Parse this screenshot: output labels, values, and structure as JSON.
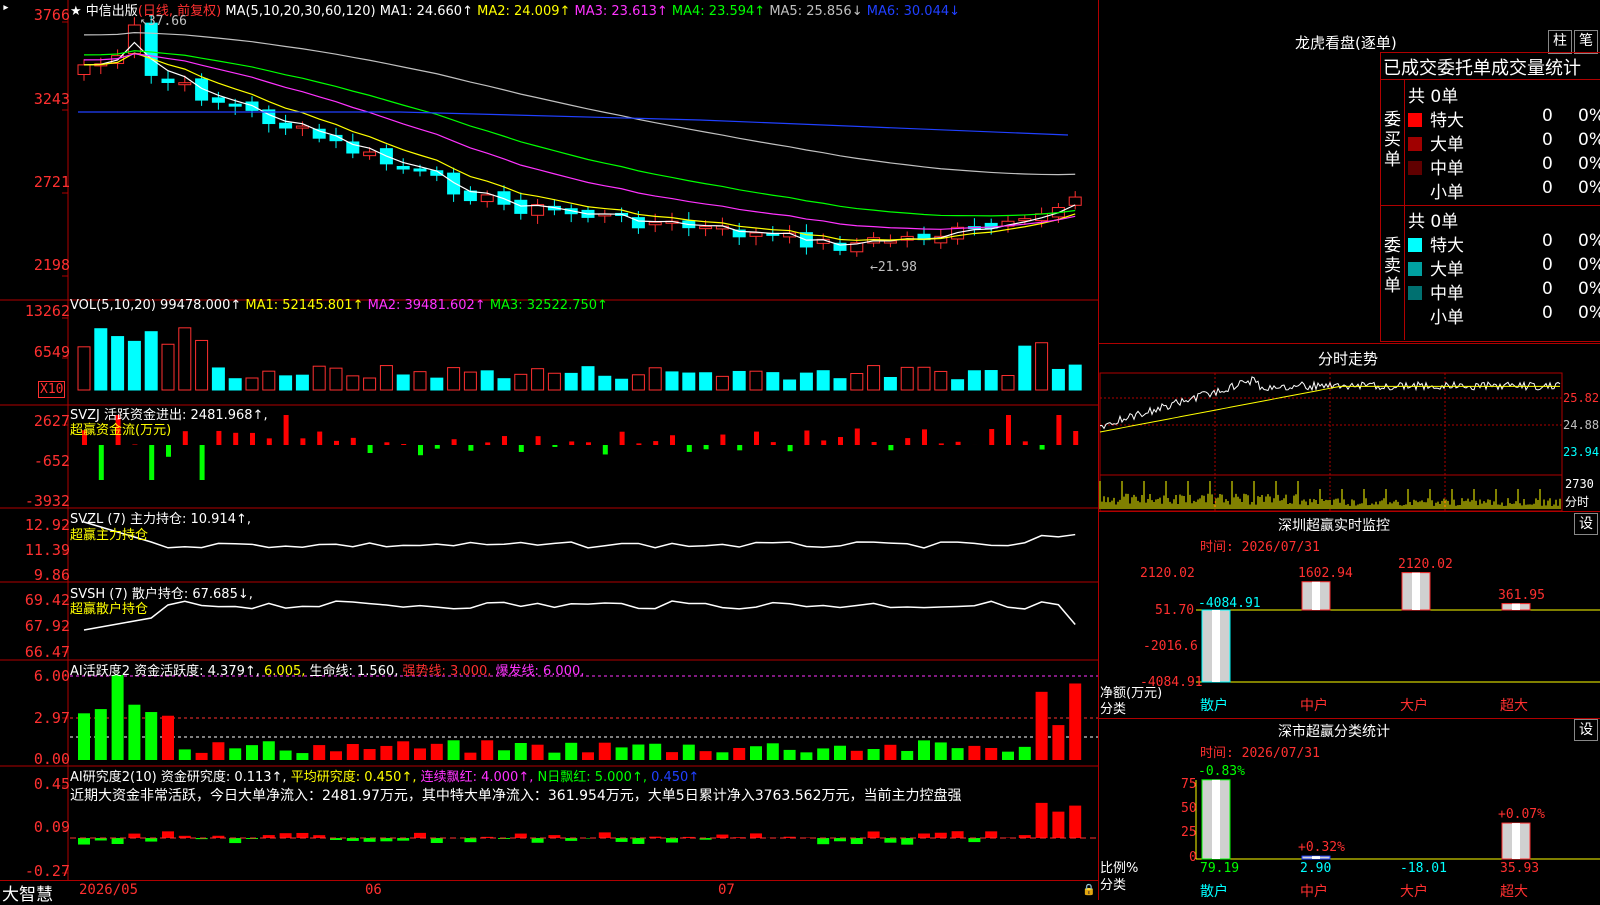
{
  "stock": {
    "star": "★",
    "name": "中信出版",
    "period": "(日线, 前复权)"
  },
  "main_ma": {
    "label": "MA(5,10,20,30,60,120)",
    "items": [
      {
        "text": "MA1: 24.660↑",
        "color": "#ffffff"
      },
      {
        "text": "MA2: 24.009↑",
        "color": "#ffff00"
      },
      {
        "text": "MA3: 23.613↑",
        "color": "#ff33ff"
      },
      {
        "text": "MA4: 23.594↑",
        "color": "#00ff00"
      },
      {
        "text": "MA5: 25.856↓",
        "color": "#c0c0c0"
      },
      {
        "text": "MA6: 30.044↓",
        "color": "#2040ff"
      }
    ]
  },
  "price_axis": [
    "3766",
    "3243",
    "2721",
    "2198"
  ],
  "price_high_label": "37.66",
  "price_low_label": "←21.98",
  "vol": {
    "label": "VOL(5,10,20)",
    "value": "99478.000↑",
    "items": [
      {
        "text": "MA1: 52145.801↑",
        "color": "#ffff00"
      },
      {
        "text": "MA2: 39481.602↑",
        "color": "#ff33ff"
      },
      {
        "text": "MA3: 32522.750↑",
        "color": "#00ff00"
      }
    ],
    "axis": [
      "13262",
      "6549"
    ],
    "unit": "X10"
  },
  "svzj": {
    "label": "SVZJ  活跃资金进出: 2481.968↑,",
    "sub": "超赢资金流(万元)",
    "axis": [
      "2627",
      "-652",
      "-3932"
    ]
  },
  "svzl": {
    "label": "SVZL (7) 主力持仓: 10.914↑,",
    "sub": "超赢主力持仓",
    "axis": [
      "12.92",
      "11.39",
      "9.86"
    ]
  },
  "svsh": {
    "label": "SVSH (7) 散户持仓: 67.685↓,",
    "sub": "超赢散户持仓",
    "axis": [
      "69.42",
      "67.92",
      "66.47"
    ]
  },
  "ai1": {
    "parts": [
      {
        "text": "AI活跃度2 资金活跃度: 4.379↑,",
        "color": "#ffffff"
      },
      {
        "text": "6.005,",
        "color": "#ffff00"
      },
      {
        "text": "生命线: 1.560,",
        "color": "#ffffff"
      },
      {
        "text": "强势线: 3.000,",
        "color": "#ff3030"
      },
      {
        "text": "爆发线: 6.000,",
        "color": "#ff33ff"
      }
    ],
    "axis": [
      "6.00",
      "2.97",
      "0.00"
    ]
  },
  "ai2": {
    "parts": [
      {
        "text": "AI研究度2(10) 资金研究度: 0.113↑,",
        "color": "#ffffff"
      },
      {
        "text": "平均研究度: 0.450↑,",
        "color": "#ffff00"
      },
      {
        "text": "连续飘红: 4.000↑,",
        "color": "#ff33ff"
      },
      {
        "text": "N日飘红: 5.000↑,",
        "color": "#00ff00"
      },
      {
        "text": "0.450↑",
        "color": "#2040ff"
      }
    ],
    "note": "近期大资金非常活跃，今日大单净流入：2481.97万元，其中特大单净流入：361.954万元，大单5日累计净入3763.562万元，当前主力控盘强",
    "axis": [
      "0.45",
      "0.09",
      "-0.27"
    ]
  },
  "dates": [
    "2026/05",
    "06",
    "07"
  ],
  "footer": {
    "brand": "大智慧"
  },
  "right": {
    "lhkp_title": "龙虎看盘(逐单)",
    "btn_zhu": "柱",
    "btn_bi": "笔",
    "tabs_header": "已成交委托单成交量统计",
    "buy": {
      "side": "委买单",
      "total": "共 0单",
      "rows": [
        {
          "label": "特大",
          "count": "0",
          "pct": "0%",
          "color": "#ff0000"
        },
        {
          "label": "大单",
          "count": "0",
          "pct": "0%",
          "color": "#a00000"
        },
        {
          "label": "中单",
          "count": "0",
          "pct": "0%",
          "color": "#600000"
        },
        {
          "label": "小单",
          "count": "0",
          "pct": "0%",
          "color": "#000000"
        }
      ]
    },
    "sell": {
      "side": "委卖单",
      "total": "共 0单",
      "rows": [
        {
          "label": "特大",
          "count": "0",
          "pct": "0%",
          "color": "#00ffff"
        },
        {
          "label": "大单",
          "count": "0",
          "pct": "0%",
          "color": "#00a0a0"
        },
        {
          "label": "中单",
          "count": "0",
          "pct": "0%",
          "color": "#007070"
        },
        {
          "label": "小单",
          "count": "0",
          "pct": "0%",
          "color": "#000000"
        }
      ]
    },
    "intraday": {
      "title": "分时走势",
      "axis": [
        "25.82",
        "24.88",
        "23.94"
      ],
      "vol_axis": "2730",
      "vol_unit": "分时"
    },
    "sz_monitor": {
      "title": "深圳超赢实时监控",
      "btn": "设",
      "time": "时间: 2026/07/31",
      "axis": [
        "2120.02",
        "51.70",
        "-2016.6",
        "-4084.91"
      ],
      "ylabel": "净额(万元)",
      "xlabel": "分类",
      "bars": [
        {
          "cat": "散户",
          "label": "-4084.91",
          "value": -4084.91,
          "label_color": "#00ffff"
        },
        {
          "cat": "中户",
          "label": "1602.94",
          "value": 1602.94,
          "label_color": "#ff3030"
        },
        {
          "cat": "大户",
          "label": "2120.02",
          "value": 2120.02,
          "label_color": "#ff3030"
        },
        {
          "cat": "超大",
          "label": "361.95",
          "value": 361.95,
          "label_color": "#ff3030"
        }
      ]
    },
    "sz_stats": {
      "title": "深市超赢分类统计",
      "btn": "设",
      "time": "时间: 2026/07/31",
      "axis": [
        "75",
        "50",
        "25",
        "0"
      ],
      "ylabel": "比例%",
      "xlabel": "分类",
      "bars": [
        {
          "cat": "散户",
          "top": "-0.83%",
          "bottom": "79.19",
          "value": 79.19,
          "top_color": "#00ff00",
          "bottom_color": "#00ff00"
        },
        {
          "cat": "中户",
          "top": "+0.32%",
          "bottom": "2.90",
          "value": 2.9,
          "top_color": "#ff3030",
          "bottom_color": "#00ffff"
        },
        {
          "cat": "大户",
          "top": "",
          "bottom": "-18.01",
          "value": 0,
          "top_color": "#ff3030",
          "bottom_color": "#00ffff"
        },
        {
          "cat": "超大",
          "top": "+0.07%",
          "bottom": "35.93",
          "value": 35.93,
          "top_color": "#ff3030",
          "bottom_color": "#ff3030"
        }
      ]
    }
  }
}
